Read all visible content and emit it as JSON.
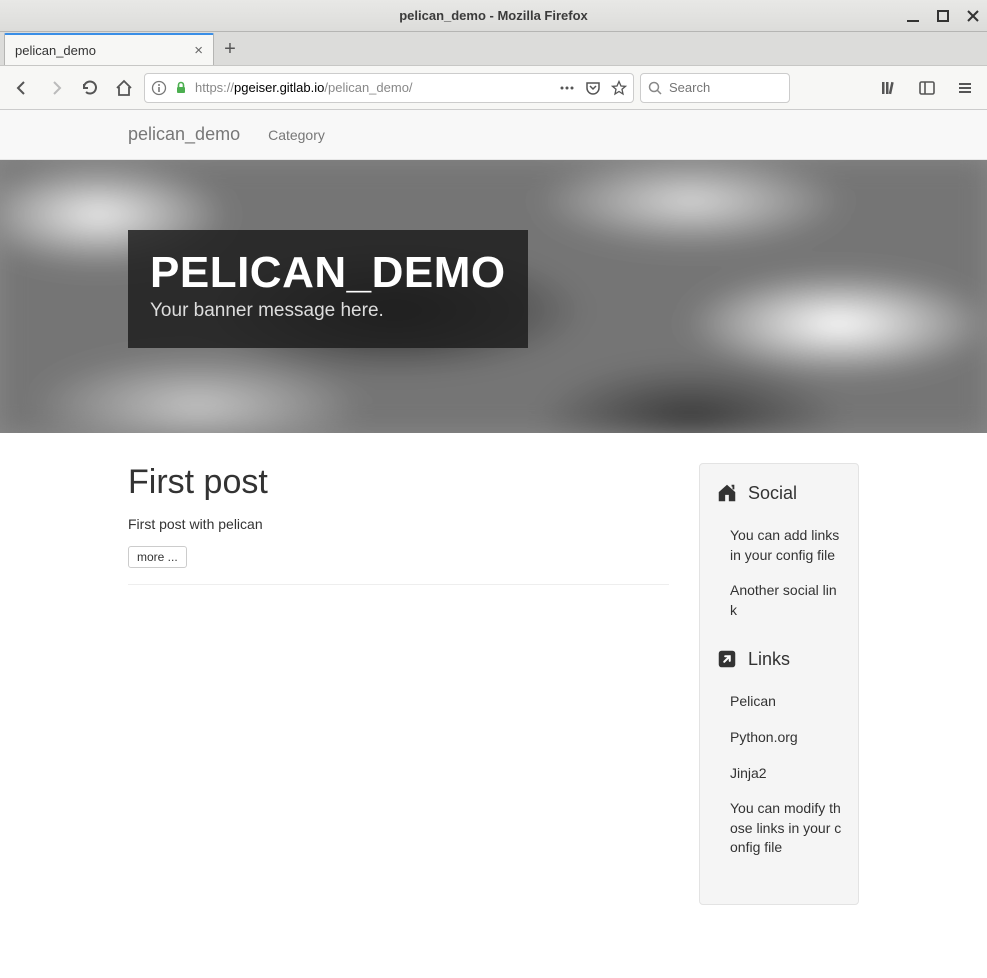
{
  "window": {
    "title": "pelican_demo - Mozilla Firefox"
  },
  "tabs": {
    "active_label": "pelican_demo"
  },
  "addressbar": {
    "scheme": "https://",
    "host": "pgeiser.gitlab.io",
    "path": "/pelican_demo/"
  },
  "searchbar": {
    "placeholder": "Search"
  },
  "navbar": {
    "brand": "pelican_demo",
    "items": [
      "Category"
    ]
  },
  "banner": {
    "title": "PELICAN_DEMO",
    "subtitle": "Your banner message here."
  },
  "post": {
    "title": "First post",
    "excerpt": "First post with pelican",
    "more_label": "more ..."
  },
  "sidebar": {
    "social_heading": "Social",
    "social_items": [
      "You can add links in your config file",
      "Another social link"
    ],
    "links_heading": "Links",
    "links_items": [
      "Pelican",
      "Python.org",
      "Jinja2",
      "You can modify those links in your config file"
    ]
  }
}
